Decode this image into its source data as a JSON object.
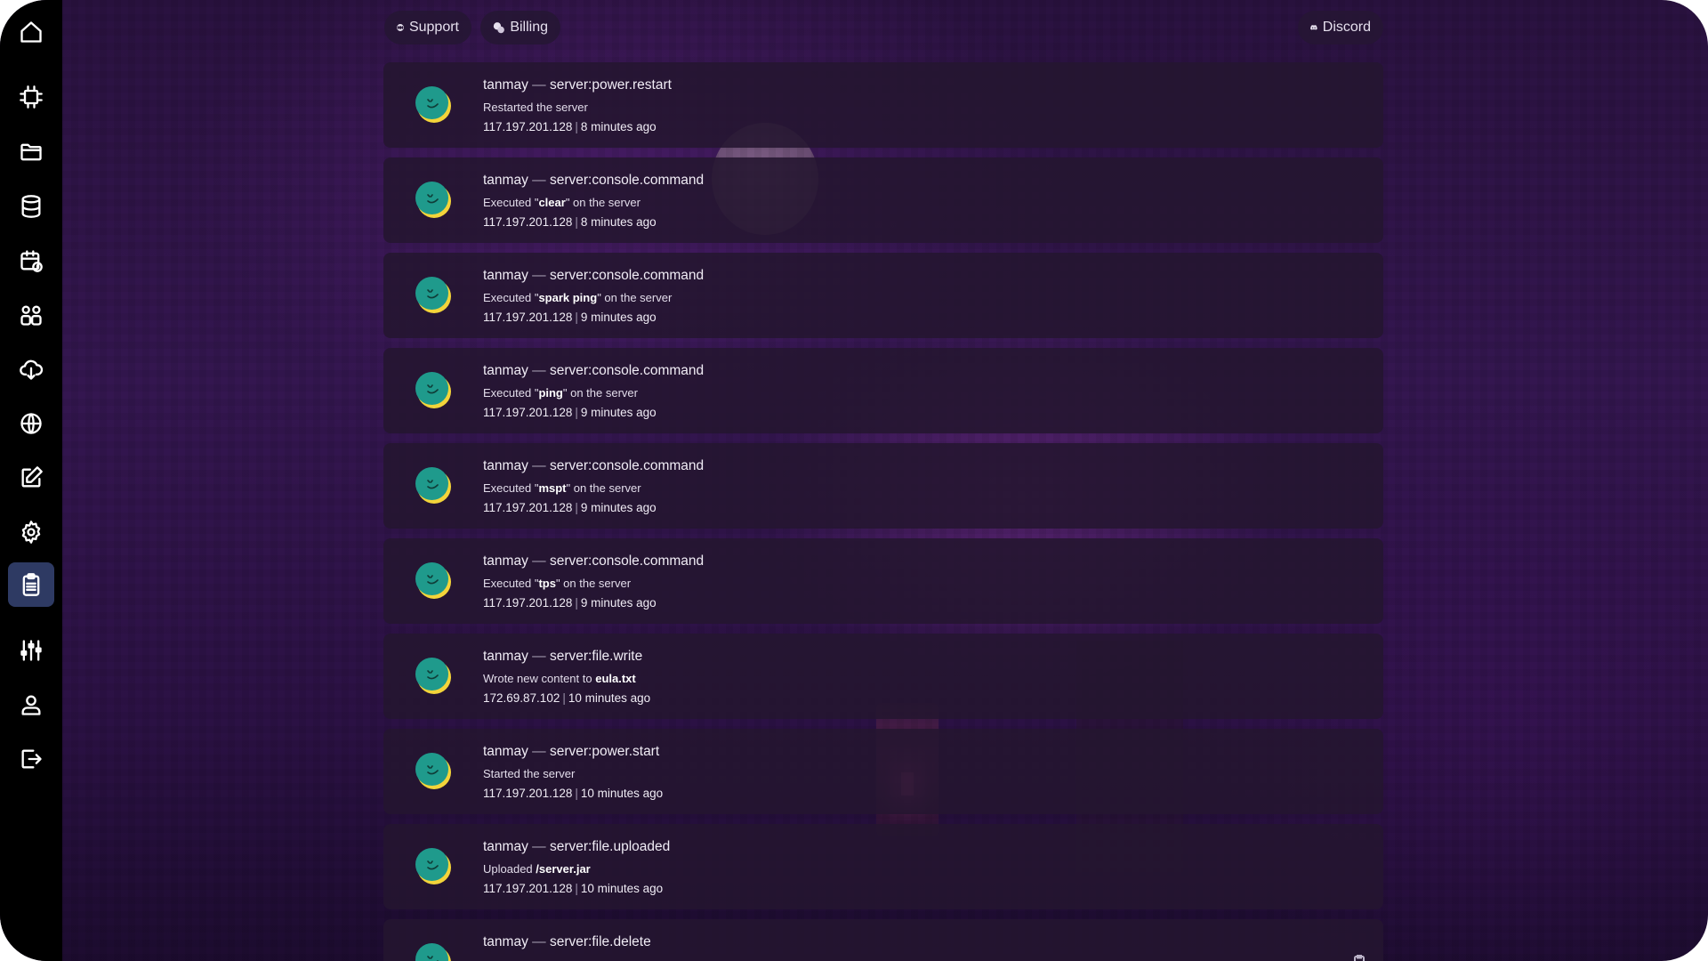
{
  "topbar": {
    "support_label": "Support",
    "billing_label": "Billing",
    "discord_label": "Discord"
  },
  "sidebar": {
    "items": [
      {
        "name": "home",
        "icon": "home-icon",
        "active": false
      },
      {
        "name": "console",
        "icon": "cpu-icon",
        "active": false
      },
      {
        "name": "files",
        "icon": "folder-icon",
        "active": false
      },
      {
        "name": "databases",
        "icon": "database-icon",
        "active": false
      },
      {
        "name": "schedules",
        "icon": "calendar-clock-icon",
        "active": false
      },
      {
        "name": "users",
        "icon": "users-icon",
        "active": false
      },
      {
        "name": "backups",
        "icon": "cloud-download-icon",
        "active": false
      },
      {
        "name": "network",
        "icon": "globe-icon",
        "active": false
      },
      {
        "name": "startup",
        "icon": "edit-icon",
        "active": false
      },
      {
        "name": "settings",
        "icon": "gear-icon",
        "active": false
      },
      {
        "name": "activity",
        "icon": "clipboard-icon",
        "active": true
      },
      {
        "name": "admin",
        "icon": "sliders-icon",
        "active": false
      },
      {
        "name": "account",
        "icon": "user-icon",
        "active": false
      },
      {
        "name": "logout",
        "icon": "logout-icon",
        "active": false
      }
    ]
  },
  "events": [
    {
      "user": "tanmay",
      "dash": "—",
      "event": "server:power.restart",
      "desc_pre": "Restarted the server",
      "desc_bold": "",
      "desc_post": "",
      "ip": "117.197.201.128",
      "sep": "|",
      "time": "8 minutes ago"
    },
    {
      "user": "tanmay",
      "dash": "—",
      "event": "server:console.command",
      "desc_pre": "Executed \"",
      "desc_bold": "clear",
      "desc_post": "\" on the server",
      "ip": "117.197.201.128",
      "sep": "|",
      "time": "8 minutes ago"
    },
    {
      "user": "tanmay",
      "dash": "—",
      "event": "server:console.command",
      "desc_pre": "Executed \"",
      "desc_bold": "spark ping",
      "desc_post": "\" on the server",
      "ip": "117.197.201.128",
      "sep": "|",
      "time": "9 minutes ago"
    },
    {
      "user": "tanmay",
      "dash": "—",
      "event": "server:console.command",
      "desc_pre": "Executed \"",
      "desc_bold": "ping",
      "desc_post": "\" on the server",
      "ip": "117.197.201.128",
      "sep": "|",
      "time": "9 minutes ago"
    },
    {
      "user": "tanmay",
      "dash": "—",
      "event": "server:console.command",
      "desc_pre": "Executed \"",
      "desc_bold": "mspt",
      "desc_post": "\" on the server",
      "ip": "117.197.201.128",
      "sep": "|",
      "time": "9 minutes ago"
    },
    {
      "user": "tanmay",
      "dash": "—",
      "event": "server:console.command",
      "desc_pre": "Executed \"",
      "desc_bold": "tps",
      "desc_post": "\" on the server",
      "ip": "117.197.201.128",
      "sep": "|",
      "time": "9 minutes ago"
    },
    {
      "user": "tanmay",
      "dash": "—",
      "event": "server:file.write",
      "desc_pre": "Wrote new content to ",
      "desc_bold": "eula.txt",
      "desc_post": "",
      "ip": "172.69.87.102",
      "sep": "|",
      "time": "10 minutes ago"
    },
    {
      "user": "tanmay",
      "dash": "—",
      "event": "server:power.start",
      "desc_pre": "Started the server",
      "desc_bold": "",
      "desc_post": "",
      "ip": "117.197.201.128",
      "sep": "|",
      "time": "10 minutes ago"
    },
    {
      "user": "tanmay",
      "dash": "—",
      "event": "server:file.uploaded",
      "desc_pre": "Uploaded ",
      "desc_bold": "/server.jar",
      "desc_post": "",
      "ip": "117.197.201.128",
      "sep": "|",
      "time": "10 minutes ago"
    },
    {
      "user": "tanmay",
      "dash": "—",
      "event": "server:file.delete",
      "desc_pre": "",
      "desc_bold": "",
      "desc_post": "",
      "ip": "",
      "sep": "",
      "time": ""
    }
  ]
}
